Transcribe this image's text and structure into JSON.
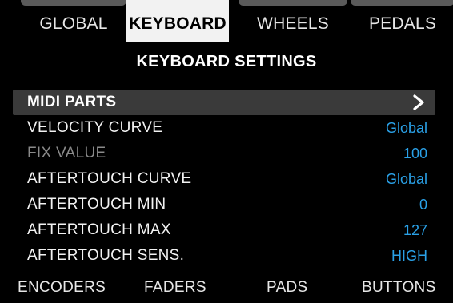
{
  "tabs": {
    "global": "GLOBAL",
    "keyboard": "KEYBOARD",
    "wheels": "WHEELS",
    "pedals": "PEDALS",
    "active": "keyboard"
  },
  "header": {
    "title": "KEYBOARD SETTINGS"
  },
  "settings": [
    {
      "label": "MIDI PARTS",
      "value": "",
      "selected": true,
      "disabled": false,
      "icon": "chevron-right-icon"
    },
    {
      "label": "VELOCITY CURVE",
      "value": "Global",
      "selected": false,
      "disabled": false
    },
    {
      "label": "FIX VALUE",
      "value": "100",
      "selected": false,
      "disabled": true
    },
    {
      "label": "AFTERTOUCH CURVE",
      "value": "Global",
      "selected": false,
      "disabled": false
    },
    {
      "label": "AFTERTOUCH MIN",
      "value": "0",
      "selected": false,
      "disabled": false
    },
    {
      "label": "AFTERTOUCH MAX",
      "value": "127",
      "selected": false,
      "disabled": false
    },
    {
      "label": "AFTERTOUCH SENS.",
      "value": "HIGH",
      "selected": false,
      "disabled": false
    }
  ],
  "softkeys": {
    "encoders": "ENCODERS",
    "faders": "FADERS",
    "pads": "PADS",
    "buttons": "BUTTONS"
  },
  "colors": {
    "background": "#000000",
    "value_accent": "#2aa0e6",
    "active_tab_bg": "#f2f2f2",
    "selected_row_bg": "#3a3a3a",
    "disabled_text": "#8a8a8a"
  }
}
